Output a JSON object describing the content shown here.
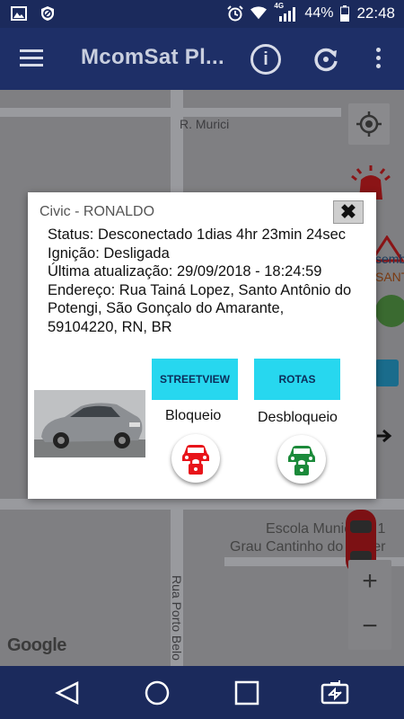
{
  "status_bar": {
    "signal_label": "4G",
    "battery": "44%",
    "time": "22:48"
  },
  "app_bar": {
    "title": "McomSat Pl..."
  },
  "map": {
    "street_top": "R. Murici",
    "street_vertical": "Rua Porto Belo",
    "school_line1": "Escola Municipal 1",
    "school_line2": "Grau Cantinho do Saber",
    "right_fragment_1": "semb",
    "right_fragment_2": "SANT",
    "google_logo": "Google",
    "zoom_in": "+",
    "zoom_out": "−"
  },
  "dialog": {
    "title": "Civic  - RONALDO",
    "close_symbol": "✖",
    "status_line": "Status: Desconectado 1dias 4hr 23min 24sec",
    "ignition_line": "Ignição: Desligada",
    "last_update_line": "Última atualização: 29/09/2018 - 18:24:59",
    "address_line": "Endereço: Rua Tainá Lopez, Santo Antônio do Potengi, São Gonçalo do Amarante, 59104220, RN, BR",
    "streetview_button": "STREETVIEW",
    "rotas_button": "ROTAS",
    "block_label": "Bloqueio",
    "unblock_label": "Desbloqueio",
    "colors": {
      "button_bg": "#27d7ef",
      "lock_red": "#e8141a",
      "lock_green": "#1b8a3a"
    }
  },
  "nav_bar": {
    "icons": [
      "back-icon",
      "home-icon",
      "recents-icon",
      "switch-screen-icon"
    ]
  }
}
